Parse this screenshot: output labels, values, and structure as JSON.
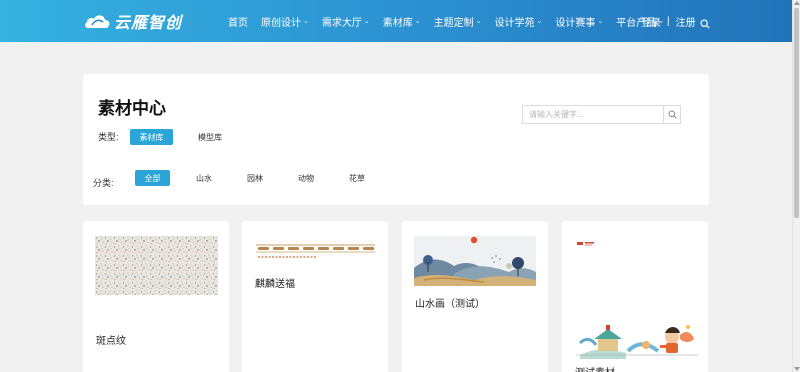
{
  "header": {
    "brand": "云雁智创",
    "nav": [
      {
        "label": "首页",
        "has_caret": false
      },
      {
        "label": "原创设计",
        "has_caret": true
      },
      {
        "label": "需求大厅",
        "has_caret": true
      },
      {
        "label": "素材库",
        "has_caret": true
      },
      {
        "label": "主题定制",
        "has_caret": true
      },
      {
        "label": "设计学苑",
        "has_caret": true
      },
      {
        "label": "设计赛事",
        "has_caret": true
      },
      {
        "label": "平台产品",
        "has_caret": true
      }
    ],
    "login": "登录",
    "separator": "|",
    "register": "注册",
    "caret": "⌄"
  },
  "panel": {
    "title": "素材中心",
    "search_placeholder": "请输入关键字...",
    "type_label": "类型:",
    "types": [
      {
        "label": "素材库",
        "active": true
      },
      {
        "label": "模型库",
        "active": false
      }
    ],
    "category_label": "分类:",
    "categories": [
      {
        "label": "全部",
        "active": true
      },
      {
        "label": "山水",
        "active": false
      },
      {
        "label": "园林",
        "active": false
      },
      {
        "label": "动物",
        "active": false
      },
      {
        "label": "花草",
        "active": false
      }
    ]
  },
  "cards": [
    {
      "title": "斑点纹",
      "thumb": "speckle-pattern-image"
    },
    {
      "title": "麒麟送福",
      "thumb": "border-pattern-image"
    },
    {
      "title": "山水画（测试）",
      "thumb": "landscape-painting-image"
    },
    {
      "title": "测试素材",
      "thumb": "illustration-image"
    }
  ],
  "colors": {
    "accent": "#2ba5d8",
    "header_start": "#35b2e0",
    "header_end": "#2173b8",
    "background": "#f1f1f1"
  }
}
